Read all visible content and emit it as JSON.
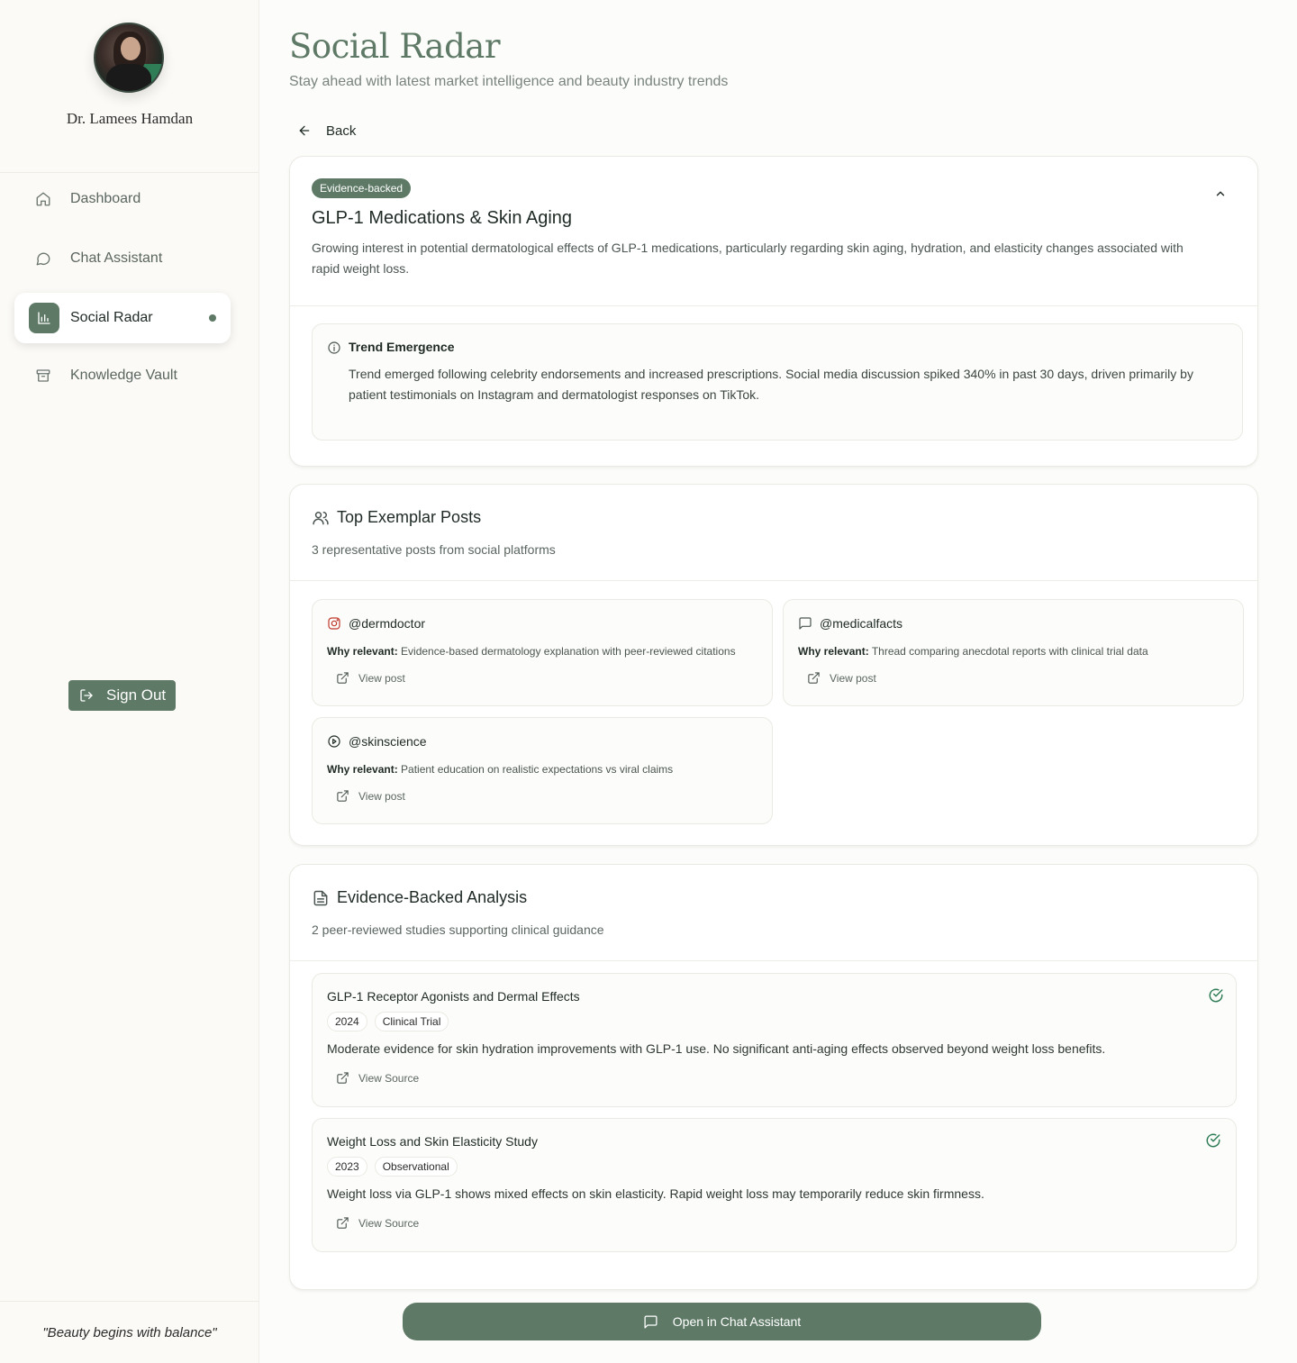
{
  "profile": {
    "name": "Dr. Lamees Hamdan"
  },
  "nav": {
    "items": [
      {
        "label": "Dashboard",
        "icon": "home-icon"
      },
      {
        "label": "Chat Assistant",
        "icon": "chat-icon"
      },
      {
        "label": "Social Radar",
        "icon": "bar-chart-icon",
        "active": true
      },
      {
        "label": "Knowledge Vault",
        "icon": "archive-icon"
      }
    ],
    "sign_out": "Sign Out"
  },
  "footer": {
    "quote": "\"Beauty begins with balance\""
  },
  "header": {
    "title": "Social Radar",
    "subtitle": "Stay ahead with latest market intelligence and beauty industry trends",
    "back_label": "Back"
  },
  "trend": {
    "badge": "Evidence-backed",
    "title": "GLP-1 Medications & Skin Aging",
    "description": "Growing interest in potential dermatological effects of GLP-1 medications, particularly regarding skin aging, hydration, and elasticity changes associated with rapid weight loss.",
    "emergence": {
      "title": "Trend Emergence",
      "text": "Trend emerged following celebrity endorsements and increased prescriptions. Social media discussion spiked 340% in past 30 days, driven primarily by patient testimonials on Instagram and dermatologist responses on TikTok."
    }
  },
  "posts": {
    "title": "Top Exemplar Posts",
    "subtitle": "3 representative posts from social platforms",
    "why_label": "Why relevant:",
    "view_label": "View post",
    "items": [
      {
        "handle": "@dermdoctor",
        "platform_icon": "instagram-icon",
        "why": "Evidence-based dermatology explanation with peer-reviewed citations"
      },
      {
        "handle": "@medicalfacts",
        "platform_icon": "comment-icon",
        "why": "Thread comparing anecdotal reports with clinical trial data"
      },
      {
        "handle": "@skinscience",
        "platform_icon": "play-circle-icon",
        "why": "Patient education on realistic expectations vs viral claims"
      }
    ]
  },
  "analysis": {
    "title": "Evidence-Backed Analysis",
    "subtitle": "2 peer-reviewed studies supporting clinical guidance",
    "view_label": "View Source",
    "studies": [
      {
        "title": "GLP-1 Receptor Agonists and Dermal Effects",
        "year": "2024",
        "type": "Clinical Trial",
        "summary": "Moderate evidence for skin hydration improvements with GLP-1 use. No significant anti-aging effects observed beyond weight loss benefits."
      },
      {
        "title": "Weight Loss and Skin Elasticity Study",
        "year": "2023",
        "type": "Observational",
        "summary": "Weight loss via GLP-1 shows mixed effects on skin elasticity. Rapid weight loss may temporarily reduce skin firmness."
      }
    ]
  },
  "cta": {
    "open_chat": "Open in Chat Assistant"
  },
  "colors": {
    "accent": "#5e7a66",
    "background": "#fcfcfa"
  }
}
